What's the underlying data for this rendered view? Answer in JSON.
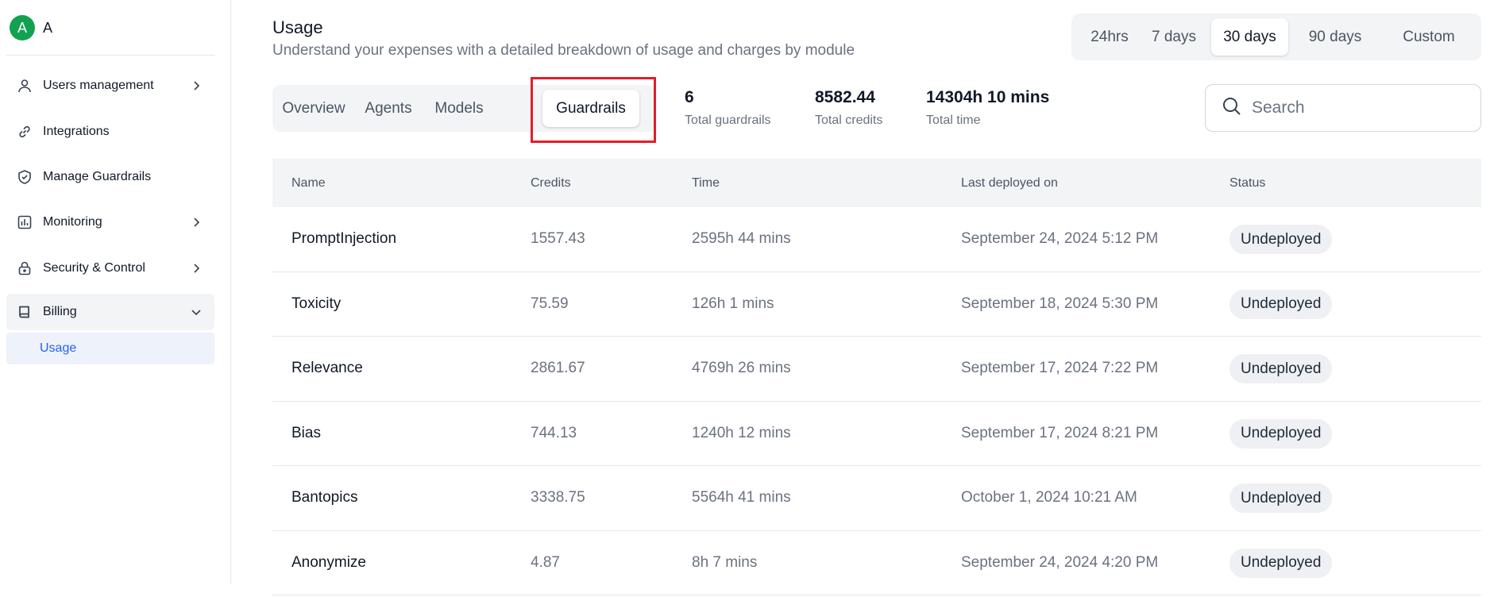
{
  "brand": {
    "avatar_letter": "A",
    "name": "A"
  },
  "sidebar": {
    "items": [
      {
        "label": "Users management",
        "icon": "user-icon",
        "has_chevron": true
      },
      {
        "label": "Integrations",
        "icon": "link-icon",
        "has_chevron": false
      },
      {
        "label": "Manage Guardrails",
        "icon": "shield-check-icon",
        "has_chevron": false
      },
      {
        "label": "Monitoring",
        "icon": "bar-chart-icon",
        "has_chevron": true
      },
      {
        "label": "Security & Control",
        "icon": "lock-icon",
        "has_chevron": true
      },
      {
        "label": "Billing",
        "icon": "book-icon",
        "has_chevron": true,
        "expanded": true
      }
    ],
    "sub_items": [
      {
        "label": "Usage",
        "active": true
      }
    ]
  },
  "page": {
    "title": "Usage",
    "subtitle": "Understand your expenses with a detailed breakdown of usage and charges by module"
  },
  "range": {
    "options": [
      "24hrs",
      "7 days",
      "30 days",
      "90 days",
      "Custom"
    ],
    "selected": "30 days"
  },
  "tabs": {
    "items": [
      "Overview",
      "Agents",
      "Models",
      "Guardrails"
    ],
    "selected": "Guardrails"
  },
  "stats": [
    {
      "value": "6",
      "label": "Total guardrails"
    },
    {
      "value": "8582.44",
      "label": "Total credits"
    },
    {
      "value": "14304h 10 mins",
      "label": "Total time"
    }
  ],
  "search": {
    "placeholder": "Search",
    "value": ""
  },
  "table": {
    "columns": [
      "Name",
      "Credits",
      "Time",
      "Last deployed on",
      "Status"
    ],
    "rows": [
      {
        "name": "PromptInjection",
        "credits": "1557.43",
        "time": "2595h 44 mins",
        "deployed": "September 24, 2024 5:12 PM",
        "status": "Undeployed"
      },
      {
        "name": "Toxicity",
        "credits": "75.59",
        "time": "126h 1 mins",
        "deployed": "September 18, 2024 5:30 PM",
        "status": "Undeployed"
      },
      {
        "name": "Relevance",
        "credits": "2861.67",
        "time": "4769h 26 mins",
        "deployed": "September 17, 2024 7:22 PM",
        "status": "Undeployed"
      },
      {
        "name": "Bias",
        "credits": "744.13",
        "time": "1240h 12 mins",
        "deployed": "September 17, 2024 8:21 PM",
        "status": "Undeployed"
      },
      {
        "name": "Bantopics",
        "credits": "3338.75",
        "time": "5564h 41 mins",
        "deployed": "October 1, 2024 10:21 AM",
        "status": "Undeployed"
      },
      {
        "name": "Anonymize",
        "credits": "4.87",
        "time": "8h 7 mins",
        "deployed": "September 24, 2024 4:20 PM",
        "status": "Undeployed"
      }
    ]
  },
  "colors": {
    "accent": "#2563eb",
    "brand": "#12a150",
    "highlight": "#e11d2a"
  }
}
